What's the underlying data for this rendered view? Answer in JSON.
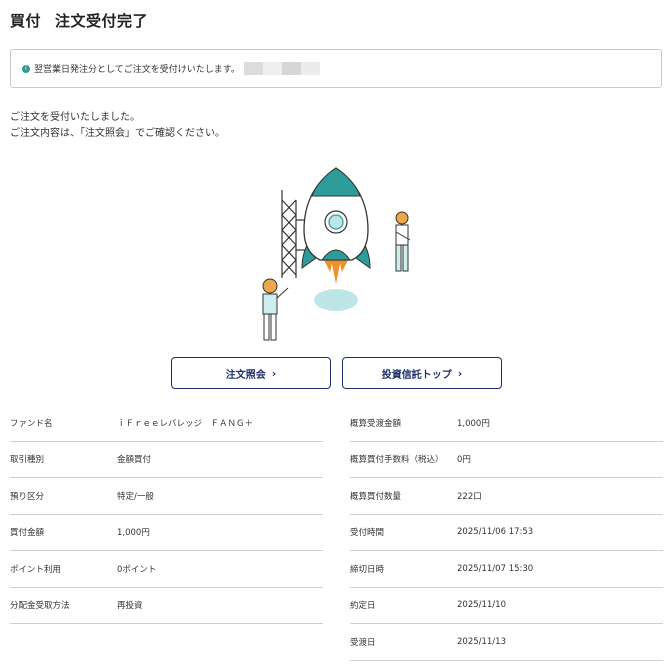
{
  "page": {
    "title_part1": "買付",
    "title_part2": "注文受付完了"
  },
  "notice": {
    "text": "翌営業日発注分としてご注文を受付けいたします。"
  },
  "message": {
    "line1": "ご注文を受付いたしました。",
    "line2": "ご注文内容は、「注文照会」でご確認ください。"
  },
  "buttons": {
    "order_inquiry": "注文照会",
    "fund_top": "投資信託トップ",
    "chevron": "＞"
  },
  "left_table": [
    {
      "label": "ファンド名",
      "value": "ｉＦｒｅｅレバレッジ　ＦＡＮＧ＋"
    },
    {
      "label": "取引種別",
      "value": "金額買付"
    },
    {
      "label": "預り区分",
      "value": "特定/一般"
    },
    {
      "label": "買付金額",
      "value": "1,000円"
    },
    {
      "label": "ポイント利用",
      "value": "0ポイント"
    },
    {
      "label": "分配金受取方法",
      "value": "再投資"
    }
  ],
  "right_table": [
    {
      "label": "概算受渡金額",
      "value": "1,000円"
    },
    {
      "label": "概算買付手数料（税込）",
      "value": "0円"
    },
    {
      "label": "概算買付数量",
      "value": "222口"
    },
    {
      "label": "受付時間",
      "value": "2025/11/06 17:53"
    },
    {
      "label": "締切日時",
      "value": "2025/11/07 15:30"
    },
    {
      "label": "約定日",
      "value": "2025/11/10"
    },
    {
      "label": "受渡日",
      "value": "2025/11/13"
    }
  ],
  "colors": {
    "accent_teal": "#2f9c9c",
    "button_navy": "#1f2f6b",
    "rocket_flame": "#f0902a"
  }
}
